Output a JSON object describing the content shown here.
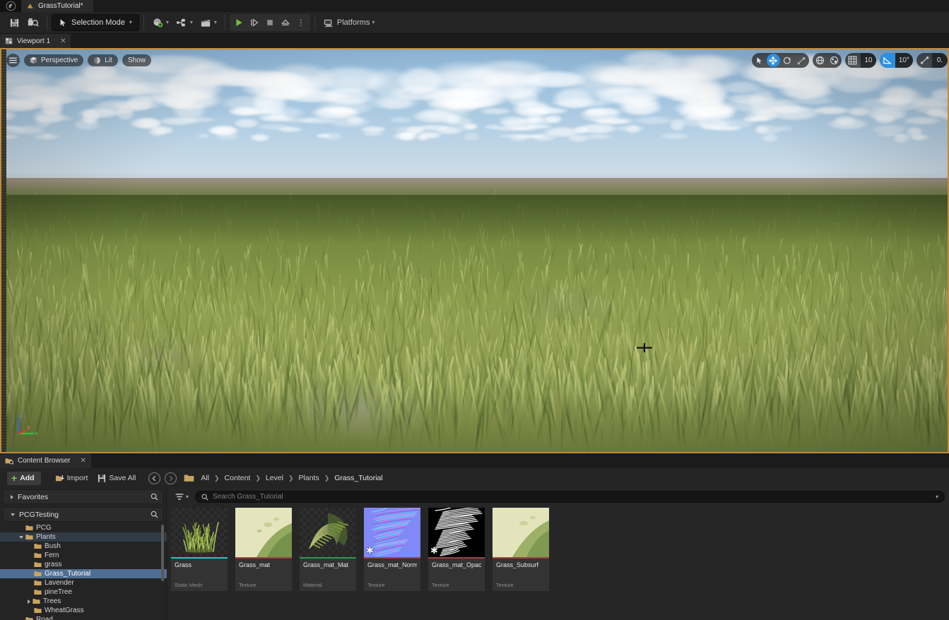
{
  "titlebar": {
    "app_icon": "unreal-orb-icon",
    "level_tab": {
      "label": "GrassTutorial*",
      "icon": "level-icon"
    }
  },
  "toolbar": {
    "save_label": "save-icon",
    "source_control_label": "source-control-icon",
    "mode": {
      "label": "Selection Mode",
      "icon": "cursor-icon",
      "chevron": "▾"
    },
    "create_label": "add-actor-icon",
    "blueprints_label": "blueprints-icon",
    "cinematics_label": "cinematics-icon",
    "play_label": "play-icon",
    "skip_label": "step-icon",
    "stop_label": "stop-icon",
    "eject_label": "eject-icon",
    "more_label": "⋮",
    "platforms": {
      "label": "Platforms",
      "icon": "platforms-icon",
      "chevron": "▾"
    }
  },
  "viewport": {
    "tab": {
      "label": "Viewport 1",
      "close": "✕",
      "icon": "viewport-icon"
    },
    "menu_icon": "hamburger-icon",
    "perspective": {
      "label": "Perspective",
      "icon": "cube-icon"
    },
    "lighting": {
      "label": "Lit",
      "icon": "sphere-icon"
    },
    "show": {
      "label": "Show"
    },
    "gizmos": [
      {
        "name": "select-tool",
        "icon": "arrow-icon",
        "active": false
      },
      {
        "name": "move-tool",
        "icon": "move-icon",
        "active": true
      },
      {
        "name": "rotate-tool",
        "icon": "rotate-icon",
        "active": false
      },
      {
        "name": "scale-tool",
        "icon": "scale-icon",
        "active": false
      }
    ],
    "coord_space": {
      "name": "world-coordinate-icon",
      "icon": "globe-icon"
    },
    "surface_snap": {
      "name": "surface-snap-icon",
      "icon": "surface-snap-icon"
    },
    "grid_snap": {
      "icon": "grid-icon",
      "value": "10",
      "enabled": false
    },
    "angle_snap": {
      "icon": "angle-icon",
      "value": "10°",
      "enabled": true
    },
    "scale_snap": {
      "icon": "scale-snap-icon",
      "value": "0."
    },
    "axis_gizmo": {
      "x": "X",
      "y": "Y",
      "z": "Z"
    },
    "cursor": "crosshair-cursor"
  },
  "content_browser": {
    "tab": {
      "label": "Content Browser",
      "close": "✕",
      "icon": "content-browser-icon"
    },
    "add_button": {
      "label": "Add",
      "plus": "+"
    },
    "import_button": {
      "label": "Import",
      "icon": "import-icon"
    },
    "save_all_button": {
      "label": "Save All",
      "icon": "save-icon"
    },
    "nav_back": "←",
    "nav_forward": "→",
    "breadcrumb": [
      "All",
      "Content",
      "Level",
      "Plants",
      "Grass_Tutorial"
    ],
    "breadcrumb_separator": "❯",
    "search": {
      "placeholder": "Search Grass_Tutorial",
      "value": "",
      "icon": "search-icon",
      "chevron": "▾"
    },
    "filter": {
      "icon": "filter-icon",
      "chevron": "▾"
    },
    "tree": {
      "favorites": {
        "label": "Favorites",
        "expanded": false,
        "search_icon": "search-icon"
      },
      "root": {
        "label": "PCGTesting",
        "expanded": true,
        "search_icon": "search-icon"
      },
      "items": [
        {
          "label": "PCG",
          "depth": 1,
          "state": "normal",
          "expandable": false
        },
        {
          "label": "Plants",
          "depth": 1,
          "state": "highlight",
          "expandable": true,
          "expanded": true
        },
        {
          "label": "Bush",
          "depth": 2,
          "state": "normal",
          "expandable": false
        },
        {
          "label": "Fern",
          "depth": 2,
          "state": "normal",
          "expandable": false
        },
        {
          "label": "grass",
          "depth": 2,
          "state": "normal",
          "expandable": false
        },
        {
          "label": "Grass_Tutorial",
          "depth": 2,
          "state": "selected",
          "expandable": false
        },
        {
          "label": "Lavender",
          "depth": 2,
          "state": "normal",
          "expandable": false
        },
        {
          "label": "pineTree",
          "depth": 2,
          "state": "normal",
          "expandable": false
        },
        {
          "label": "Trees",
          "depth": 2,
          "state": "normal",
          "expandable": true,
          "expanded": false
        },
        {
          "label": "WheatGrass",
          "depth": 2,
          "state": "normal",
          "expandable": false
        },
        {
          "label": "Road",
          "depth": 1,
          "state": "normal",
          "expandable": false
        }
      ]
    },
    "assets": [
      {
        "name": "Grass",
        "type": "Static Mesh",
        "bar_color": "#1fc8c8",
        "thumb": "grass-mesh-thumb",
        "dirty": false
      },
      {
        "name": "Grass_mat",
        "type": "Texture",
        "bar_color": "#a04040",
        "thumb": "grass-albedo-thumb",
        "dirty": false
      },
      {
        "name": "Grass_mat_Mat",
        "type": "Material",
        "bar_color": "#2d9b4f",
        "thumb": "grass-material-thumb",
        "dirty": false
      },
      {
        "name": "Grass_mat_Normal",
        "type": "Texture",
        "bar_color": "#a04040",
        "thumb": "normal-map-thumb",
        "dirty": true
      },
      {
        "name": "Grass_mat_Opacity",
        "type": "Texture",
        "bar_color": "#a04040",
        "thumb": "opacity-map-thumb",
        "dirty": true
      },
      {
        "name": "Grass_Subsurf",
        "type": "Texture",
        "bar_color": "#a04040",
        "thumb": "subsurface-thumb",
        "dirty": false
      }
    ]
  }
}
